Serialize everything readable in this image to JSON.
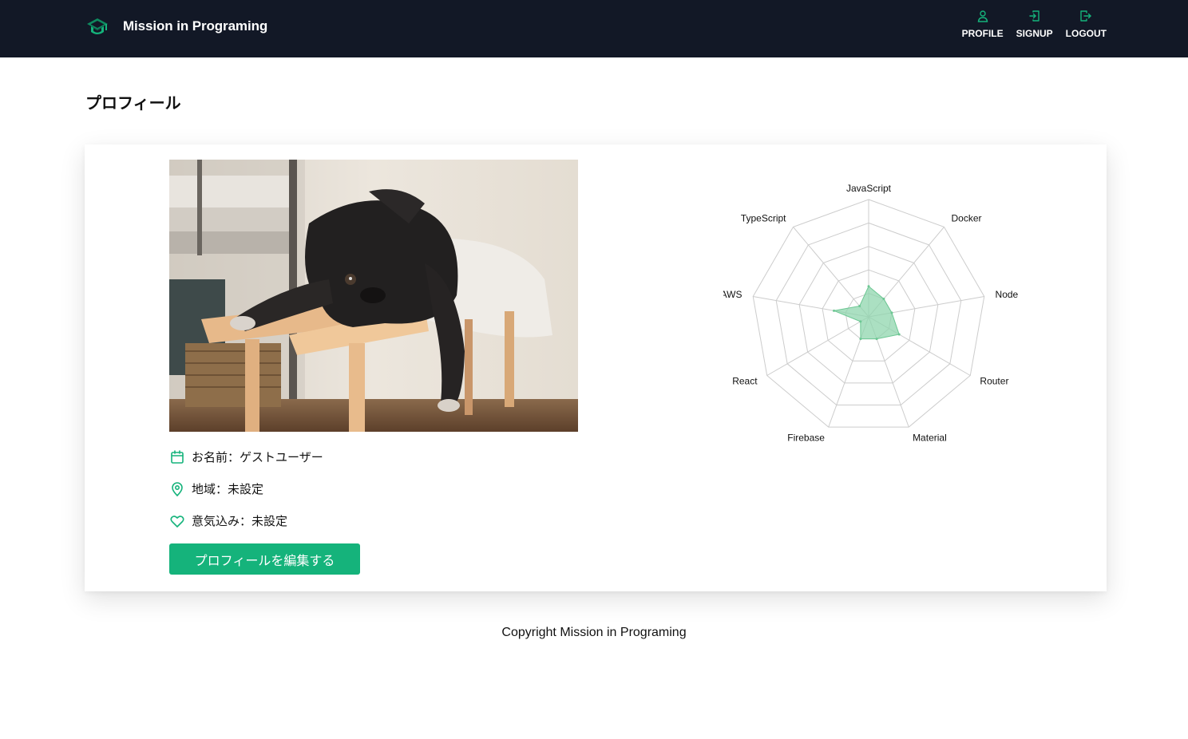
{
  "header": {
    "brand": "Mission in Programing",
    "nav": [
      {
        "label": "PROFILE",
        "icon": "user-icon"
      },
      {
        "label": "SIGNUP",
        "icon": "login-icon"
      },
      {
        "label": "LOGOUT",
        "icon": "logout-icon"
      }
    ]
  },
  "page": {
    "title": "プロフィール"
  },
  "profile": {
    "photo_alt": "pug-dog-photo",
    "name_line": "お名前：ゲストユーザー",
    "region_line": "地域：未設定",
    "motivation_line": "意気込み：未設定",
    "edit_button": "プロフィールを編集する"
  },
  "chart_data": {
    "type": "radar",
    "categories": [
      "JavaScript",
      "Docker",
      "Node",
      "Router",
      "Material",
      "Firebase",
      "React",
      "AWS",
      "TypeScript"
    ],
    "values": [
      1.3,
      1.0,
      1.0,
      1.5,
      1.0,
      1.0,
      0.4,
      1.5,
      0.6
    ],
    "rmax": 5,
    "grid_levels": 5,
    "fill_color": "#8fd6ad",
    "stroke_color": "#6cc793"
  },
  "footer": {
    "copyright": "Copyright Mission in Programing"
  },
  "colors": {
    "header_bg": "#121826",
    "accent": "#15b37b"
  }
}
